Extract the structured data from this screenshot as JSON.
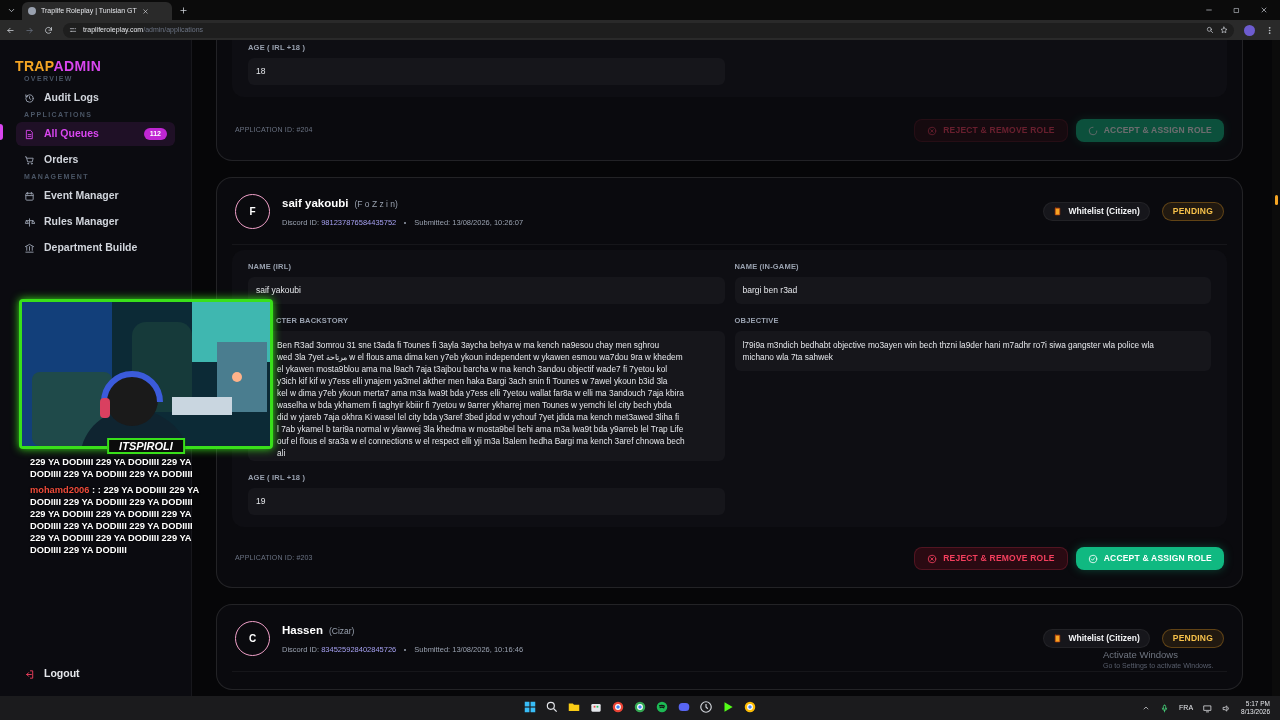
{
  "browser": {
    "tab_title": "Traplife Roleplay | Tunisian GT",
    "url_host": "trapliferoleplay.com",
    "url_path": "/admin/applications"
  },
  "sidebar": {
    "logo_a": "TRAP",
    "logo_b": "ADMIN",
    "sections": [
      {
        "title": "OVERVIEW",
        "items": [
          {
            "label": "Audit Logs",
            "selected": false
          }
        ]
      },
      {
        "title": "APPLICATIONS",
        "items": [
          {
            "label": "All Queues",
            "selected": true,
            "badge": "112"
          },
          {
            "label": "Orders",
            "selected": false
          }
        ]
      },
      {
        "title": "MANAGEMENT",
        "items": [
          {
            "label": "Event Manager",
            "selected": false
          },
          {
            "label": "Rules Manager",
            "selected": false
          },
          {
            "label": "Department Builde",
            "selected": false
          }
        ]
      }
    ],
    "logout": "Logout"
  },
  "cards": [
    {
      "fields": [
        {
          "kind": "short",
          "label": "AGE ( IRL +18 )",
          "value": "18"
        }
      ],
      "application_id": "APPLICATION ID: #204",
      "actions": [
        {
          "kind": "reject",
          "label": "REJECT & REMOVE ROLE",
          "disabled": true,
          "loading": false
        },
        {
          "kind": "accept",
          "label": "ACCEPT & ASSIGN ROLE",
          "disabled": true,
          "loading": true
        }
      ]
    },
    {
      "avatar": "F",
      "name": "saif yakoubi",
      "alias": "(F o Z z i n)",
      "discord_label": "Discord ID:",
      "discord_id": "981237876584435752",
      "submitted": "Submitted: 13/08/2026, 10:26:07",
      "role": "Whitelist (Citizen)",
      "status": "PENDING",
      "fields": [
        {
          "kind": "short",
          "label": "NAME (IRL)",
          "value": "saif yakoubi"
        },
        {
          "kind": "short",
          "label": "NAME (IN-GAME)",
          "value": "bargi ben r3ad"
        },
        {
          "kind": "long",
          "label": "CTER BACKSTORY",
          "lines": [
            "Ben R3ad 3omrou 31 sne t3ada fi Tounes fi 3ayla 3aycha behya w ma kench na9esou chay men sghrou",
            "wed 3la 7yet مرتاحة w el flous ama dima ken y7eb ykoun independent w ykawen esmou wa7dou 9ra w khedem",
            "el ykawen mosta9blou ama ma l9ach 7aja t3ajbou barcha w ma kench 3andou objectif wade7 fi 7yetou kol",
            "y3ich kif kif w y7ess elli ynajem ya3mel akther men haka Bargi 3ach snin fi Tounes w 7awel ykoun b3id 3la",
            "kel w dima y7eb ykoun merta7 ama m3a lwa9t bda y7ess elli 7yetou wallat far8a w elli ma 3andouch 7aja kbira",
            "waselha w bda ykhamem fi taghyir kbiiir fi 7yetou w 9arrer ykharrej men Tounes w yemchi lel city bech ybda",
            "did w yjareb 7aja okhra Ki wasel lel city bda y3aref 3bed jdod w ychouf 7yet jdida ma kench met3awed 3liha fi",
            "l 7ab ykamel b tari9a normal w ylawwej 3la khedma w mosta9bel behi ama m3a lwa9t bda y9arreb lel Trap Life",
            "ouf el flous el sra3a w el connections w el respect elli yji m3a l3alem hedha Bargi ma kench 3aref chnowa bech",
            "ali"
          ]
        },
        {
          "kind": "long",
          "label": "OBJECTIVE",
          "lines": [
            "l79i9a m3ndich bedhabt objective mo3ayen win bech thzni la9der hani m7adhr ro7i siwa gangster wla police wla",
            "michano wla 7ta sahwek"
          ]
        },
        {
          "kind": "short",
          "label": "AGE ( IRL +18 )",
          "value": "19"
        }
      ],
      "application_id": "APPLICATION ID: #203",
      "actions": [
        {
          "kind": "reject",
          "label": "REJECT & REMOVE ROLE",
          "disabled": false,
          "loading": false
        },
        {
          "kind": "accept",
          "label": "ACCEPT & ASSIGN ROLE",
          "disabled": false,
          "loading": false
        }
      ]
    },
    {
      "avatar": "C",
      "name": "Hassen",
      "alias": "(Cizar)",
      "discord_label": "Discord ID:",
      "discord_id": "834525928402845726",
      "submitted": "Submitted: 13/08/2026, 10:16:46",
      "role": "Whitelist (Citizen)",
      "status": "PENDING"
    }
  ],
  "stream_overlay": {
    "nameplate": "ITSPIROLI",
    "chat": [
      {
        "text": "229 YA DODIIII 229 YA DODIIII 229 YA DODIIII 229 YA DODIIII 229 YA DODIIII"
      },
      {
        "user": "mohamd2006",
        "text": ": : 229 YA DODIIII 229 YA DODIIII 229 YA DODIIII 229 YA DODIIII 229 YA DODIIII 229 YA DODIIII 229 YA DODIIII 229 YA DODIIII 229 YA DODIIII 229 YA DODIIII 229 YA DODIIII 229 YA DODIIII 229 YA DODIIII"
      }
    ]
  },
  "windows_notice": {
    "title": "Activate Windows",
    "subtitle": "Go to Settings to activate Windows."
  },
  "taskbar": {
    "language": "FRA",
    "time": "5:17 PM",
    "date": "8/13/2026"
  }
}
